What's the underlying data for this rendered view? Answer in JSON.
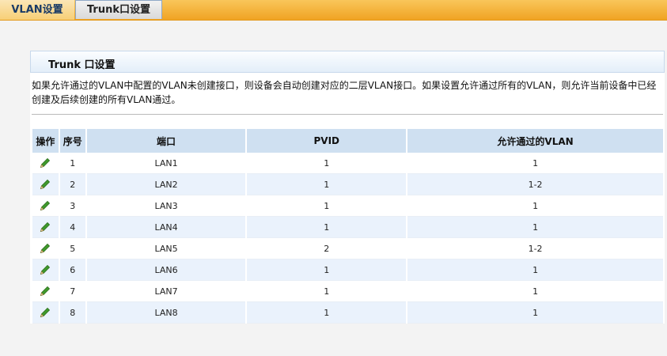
{
  "tabs": [
    {
      "label": "VLAN设置"
    },
    {
      "label": "Trunk口设置"
    }
  ],
  "section": {
    "title": "Trunk 口设置",
    "description": "如果允许通过的VLAN中配置的VLAN未创建接口，则设备会自动创建对应的二层VLAN接口。如果设置允许通过所有的VLAN，则允许当前设备中已经创建及后续创建的所有VLAN通过。"
  },
  "table": {
    "headers": [
      "操作",
      "序号",
      "端口",
      "PVID",
      "允许通过的VLAN"
    ],
    "rows": [
      {
        "index": "1",
        "port": "LAN1",
        "pvid": "1",
        "vlan": "1"
      },
      {
        "index": "2",
        "port": "LAN2",
        "pvid": "1",
        "vlan": "1-2"
      },
      {
        "index": "3",
        "port": "LAN3",
        "pvid": "1",
        "vlan": "1"
      },
      {
        "index": "4",
        "port": "LAN4",
        "pvid": "1",
        "vlan": "1"
      },
      {
        "index": "5",
        "port": "LAN5",
        "pvid": "2",
        "vlan": "1-2"
      },
      {
        "index": "6",
        "port": "LAN6",
        "pvid": "1",
        "vlan": "1"
      },
      {
        "index": "7",
        "port": "LAN7",
        "pvid": "1",
        "vlan": "1"
      },
      {
        "index": "8",
        "port": "LAN8",
        "pvid": "1",
        "vlan": "1"
      }
    ],
    "row_icon": "edit-pencil-icon"
  },
  "colors": {
    "tabbar": "#f0a323",
    "header_bg": "#cfe0f1",
    "row_alt": "#eaf2fc",
    "pencil": "#3f9a2c"
  }
}
